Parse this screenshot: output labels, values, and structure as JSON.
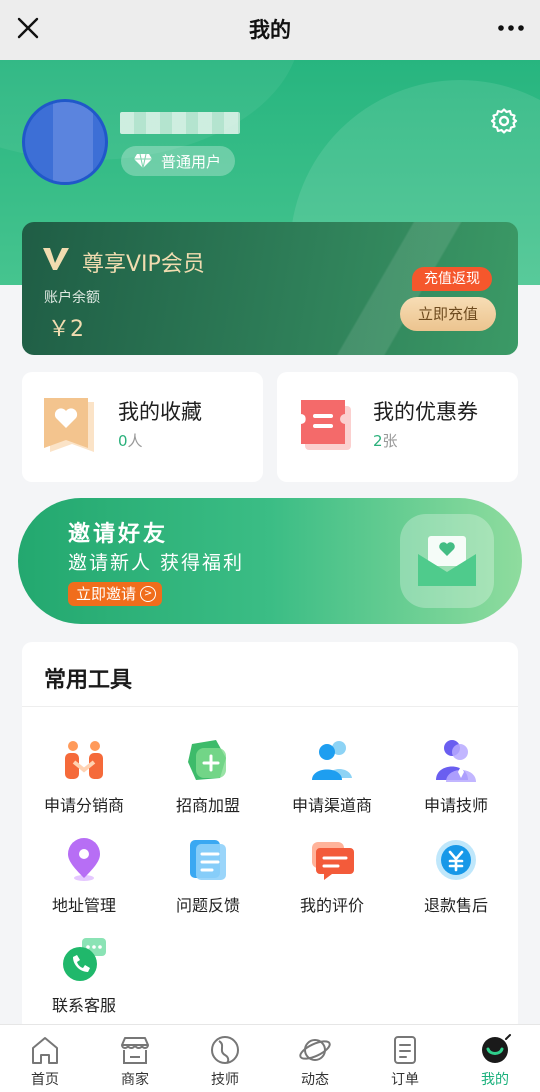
{
  "nav": {
    "title": "我的"
  },
  "profile": {
    "badge": "普通用户"
  },
  "vip": {
    "title": "尊享VIP会员",
    "balance_label": "账户余额",
    "balance": "￥2",
    "tag": "充值返现",
    "button": "立即充值"
  },
  "favorites": {
    "title": "我的收藏",
    "count": "0",
    "unit": "人"
  },
  "coupons": {
    "title": "我的优惠券",
    "count": "2",
    "unit": "张"
  },
  "invite": {
    "title": "邀请好友",
    "subtitle": "邀请新人 获得福利",
    "button": "立即邀请"
  },
  "tools": {
    "title": "常用工具",
    "items": [
      {
        "label": "申请分销商",
        "icon": "handshake-icon"
      },
      {
        "label": "招商加盟",
        "icon": "join-icon"
      },
      {
        "label": "申请渠道商",
        "icon": "channel-icon"
      },
      {
        "label": "申请技师",
        "icon": "technician-icon"
      },
      {
        "label": "地址管理",
        "icon": "location-icon"
      },
      {
        "label": "问题反馈",
        "icon": "feedback-icon"
      },
      {
        "label": "我的评价",
        "icon": "review-icon"
      },
      {
        "label": "退款售后",
        "icon": "refund-icon"
      },
      {
        "label": "联系客服",
        "icon": "phone-icon"
      }
    ]
  },
  "tabbar": {
    "items": [
      {
        "label": "首页",
        "icon": "home-icon"
      },
      {
        "label": "商家",
        "icon": "store-icon"
      },
      {
        "label": "技师",
        "icon": "technician-tab-icon"
      },
      {
        "label": "动态",
        "icon": "planet-icon"
      },
      {
        "label": "订单",
        "icon": "order-icon"
      },
      {
        "label": "我的",
        "icon": "profile-icon"
      }
    ],
    "active_color": "#19b07b"
  },
  "colors": {
    "brand_green": "#27b57f",
    "accent_orange": "#f06d1c"
  }
}
